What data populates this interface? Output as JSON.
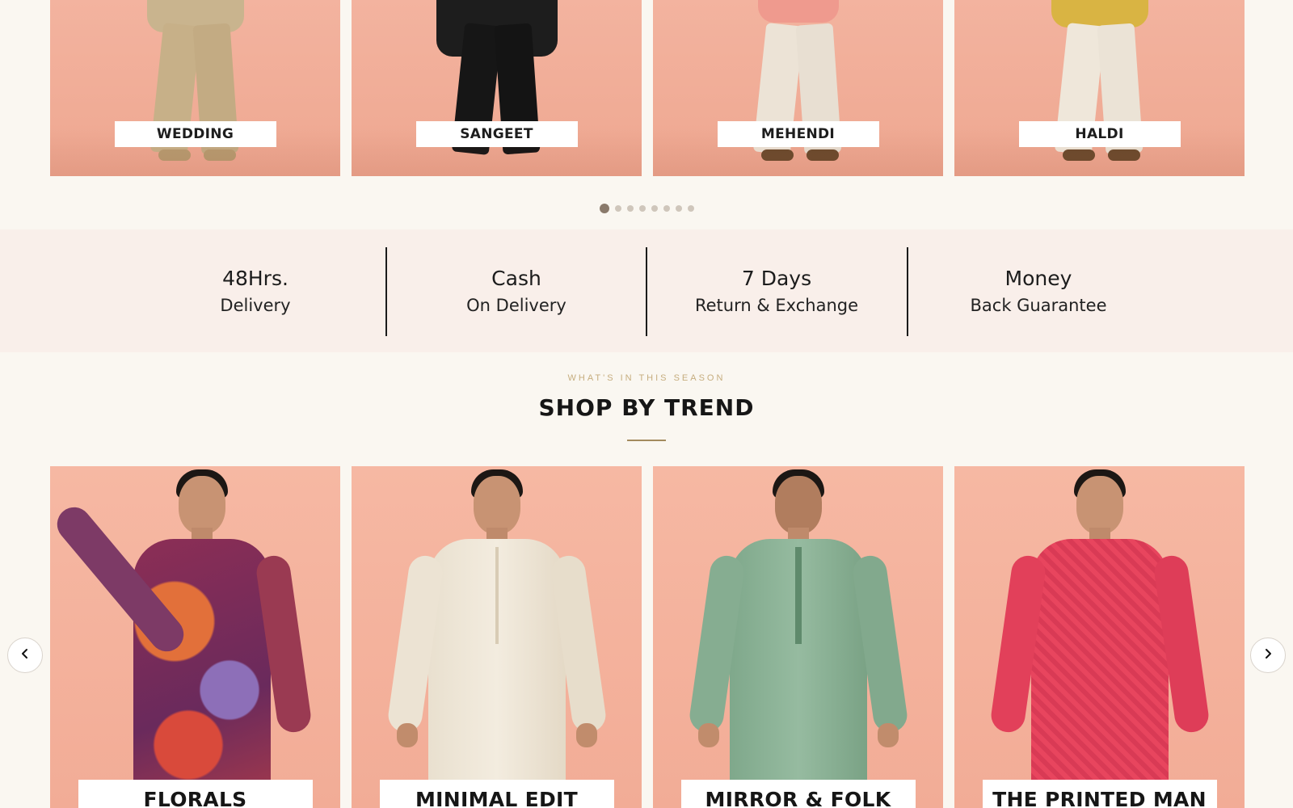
{
  "occasions": [
    {
      "label": "WEDDING"
    },
    {
      "label": "SANGEET"
    },
    {
      "label": "MEHENDI"
    },
    {
      "label": "HALDI"
    }
  ],
  "carousel": {
    "total_dots": 8,
    "active_index": 0
  },
  "features": [
    {
      "title": "48Hrs.",
      "subtitle": "Delivery"
    },
    {
      "title": "Cash",
      "subtitle": "On Delivery"
    },
    {
      "title": "7 Days",
      "subtitle": "Return & Exchange"
    },
    {
      "title": "Money",
      "subtitle": "Back Guarantee"
    }
  ],
  "section": {
    "eyebrow": "WHAT'S IN THIS SEASON",
    "title": "SHOP BY TREND"
  },
  "trends": [
    {
      "label": "FLORALS"
    },
    {
      "label": "MINIMAL EDIT"
    },
    {
      "label": "MIRROR & FOLK"
    },
    {
      "label": "THE PRINTED MAN"
    }
  ],
  "nav": {
    "prev_icon": "chevron-left-icon",
    "next_icon": "chevron-right-icon"
  },
  "colors": {
    "background": "#faf7f1",
    "card_peach": "#f2ac96",
    "features_bg": "#f9efea",
    "eyebrow_gold": "#c6ad7e",
    "rule_gold": "#a38b5e"
  }
}
